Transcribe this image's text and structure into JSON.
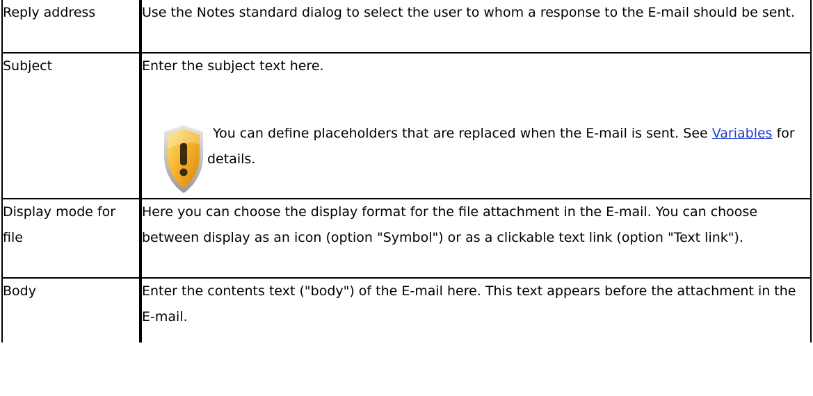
{
  "rows": [
    {
      "label": "Reply address",
      "description": "Use the Notes standard dialog to select the user to whom a response to the E-mail should be sent."
    },
    {
      "label": "Subject",
      "description": "Enter the subject text here.",
      "note": {
        "icon": "warning-shield-icon",
        "text_before": "You can define placeholders that are replaced when the E-mail is sent. See ",
        "link_text": "Variables",
        "text_after": " for details."
      }
    },
    {
      "label": "Display mode for file",
      "description": "Here you can choose the display format for the file attachment in the E-mail. You can choose between display as an icon (option \"Symbol\") or as a clickable text link (option \"Text link\")."
    },
    {
      "label": "Body",
      "description": "Enter the contents text (\"body\") of the E-mail here. This text appears before the attachment in the E-mail."
    }
  ],
  "colors": {
    "link": "#1f3fd1",
    "border": "#000000",
    "shield_orange": "#f2a01e"
  }
}
